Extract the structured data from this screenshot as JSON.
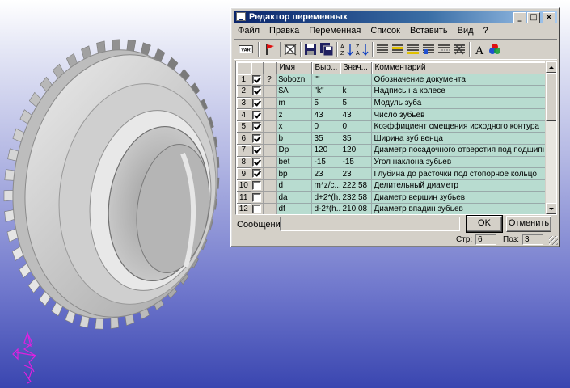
{
  "window": {
    "title": "Редактор переменных",
    "buttons": {
      "minimize": "_",
      "maximize": "□",
      "close": "×"
    }
  },
  "menu": [
    "Файл",
    "Правка",
    "Переменная",
    "Список",
    "Вставить",
    "Вид",
    "?"
  ],
  "toolbar": {
    "icons": [
      "var-icon",
      "flag-icon",
      "delete-icon",
      "save-icon",
      "save-all-icon",
      "sort-az-icon",
      "sort-za-icon",
      "list-icon",
      "list-insert-icon",
      "list-add-icon",
      "list-edit-icon",
      "list-remove-icon",
      "list-delete-icon",
      "font-icon",
      "color-icon"
    ],
    "var_label": "VAR",
    "font_label": "A"
  },
  "table": {
    "columns": [
      "Имя",
      "Выр...",
      "Знач...",
      "Комментарий"
    ],
    "rows": [
      {
        "n": "1",
        "checked": true,
        "flag": "?",
        "name": "$obozn",
        "expr": "\"\"",
        "value": "",
        "comment": "Обозначение документа"
      },
      {
        "n": "2",
        "checked": true,
        "flag": "",
        "name": "$A",
        "expr": "\"k\"",
        "value": "k",
        "comment": "Надпись на колесе"
      },
      {
        "n": "3",
        "checked": true,
        "flag": "",
        "name": "m",
        "expr": "5",
        "value": "5",
        "comment": "Модуль зуба"
      },
      {
        "n": "4",
        "checked": true,
        "flag": "",
        "name": "z",
        "expr": "43",
        "value": "43",
        "comment": "Число зубьев"
      },
      {
        "n": "5",
        "checked": true,
        "flag": "",
        "name": "x",
        "expr": "0",
        "value": "0",
        "comment": "Коэффициент смещения исходного контура"
      },
      {
        "n": "6",
        "checked": true,
        "flag": "",
        "name": "b",
        "expr": "35",
        "value": "35",
        "comment": "Ширина зуб венца"
      },
      {
        "n": "7",
        "checked": true,
        "flag": "",
        "name": "Dp",
        "expr": "120",
        "value": "120",
        "comment": "Диаметр посадочного отверстия под подшипник"
      },
      {
        "n": "8",
        "checked": true,
        "flag": "",
        "name": "bet",
        "expr": "-15",
        "value": "-15",
        "comment": "Угол наклона зубьев"
      },
      {
        "n": "9",
        "checked": true,
        "flag": "",
        "name": "bp",
        "expr": "23",
        "value": "23",
        "comment": "Глубина до расточки под стопорное кольцо"
      },
      {
        "n": "10",
        "checked": false,
        "flag": "",
        "name": "d",
        "expr": "m*z/c...",
        "value": "222.58",
        "comment": "Делительный диаметр"
      },
      {
        "n": "11",
        "checked": false,
        "flag": "",
        "name": "da",
        "expr": "d+2*(h...",
        "value": "232.58",
        "comment": "Диаметр вершин зубьев"
      },
      {
        "n": "12",
        "checked": false,
        "flag": "",
        "name": "df",
        "expr": "d-2*(h...",
        "value": "210.08",
        "comment": "Диаметр впадин зубьев"
      }
    ]
  },
  "footer": {
    "message_label": "Сообщение:",
    "message_value": "",
    "ok_label": "OK",
    "cancel_label": "Отменить",
    "row_label": "Стр:",
    "row_value": "6",
    "col_label": "Поз:",
    "col_value": "3"
  },
  "colors": {
    "title_active": "#0a246a",
    "cell_bg": "#b8dcd0",
    "dialog_bg": "#d4d0c8",
    "axis": "#e020e0"
  }
}
